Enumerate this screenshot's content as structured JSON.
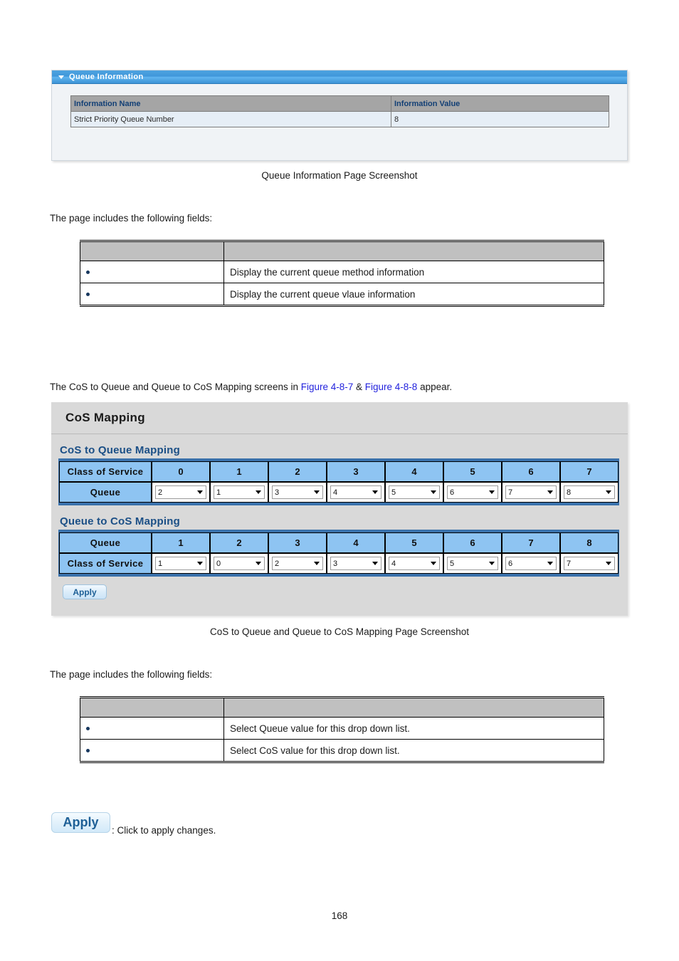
{
  "queue_information_panel": {
    "title": "Queue Information",
    "collapse_icon": "triangle-down-icon",
    "table": {
      "headers": [
        "Information Name",
        "Information Value"
      ],
      "rows": [
        {
          "name": "Strict Priority Queue Number",
          "value": "8"
        }
      ]
    }
  },
  "figure1_caption": "Queue Information Page Screenshot",
  "intro_text_1": "The page includes the following fields:",
  "field_table_1": {
    "headers": [
      "",
      ""
    ],
    "rows": [
      {
        "object": "",
        "description": "Display the current queue method information"
      },
      {
        "object": "",
        "description": "Display the current queue vlaue information"
      }
    ]
  },
  "body_text": {
    "prefix": "The CoS to Queue and Queue to CoS Mapping screens in ",
    "link1": "Figure 4-8-7",
    "middle": " & ",
    "link2": "Figure 4-8-8",
    "suffix": " appear.",
    "link_color": "#2222dd"
  },
  "cos_mapping_panel": {
    "title": "CoS Mapping",
    "cos_to_queue": {
      "section_label": "CoS to Queue Mapping",
      "row1_header": "Class of Service",
      "row1_values": [
        "0",
        "1",
        "2",
        "3",
        "4",
        "5",
        "6",
        "7"
      ],
      "row2_header": "Queue",
      "row2_selected": [
        "2",
        "1",
        "3",
        "4",
        "5",
        "6",
        "7",
        "8"
      ]
    },
    "queue_to_cos": {
      "section_label": "Queue to CoS Mapping",
      "row1_header": "Queue",
      "row1_values": [
        "1",
        "2",
        "3",
        "4",
        "5",
        "6",
        "7",
        "8"
      ],
      "row2_header": "Class of Service",
      "row2_selected": [
        "1",
        "0",
        "2",
        "3",
        "4",
        "5",
        "6",
        "7"
      ]
    },
    "apply_label": "Apply"
  },
  "figure2_caption": "CoS to Queue and Queue to CoS Mapping Page Screenshot",
  "intro_text_2": "The page includes the following fields:",
  "field_table_2": {
    "headers": [
      "",
      ""
    ],
    "rows": [
      {
        "object": "",
        "description": "Select Queue value for this drop down list."
      },
      {
        "object": "",
        "description": "Select CoS value for this drop down list."
      }
    ]
  },
  "apply_legend": {
    "button_label": "Apply",
    "description": ": Click to apply changes."
  },
  "page_number": "168",
  "colors": {
    "panel_title_blue": "#3f97da",
    "table_header_gray": "#a5a5a5",
    "table_row_lightblue": "#e6eef6",
    "map_header_blue": "#8ec4f2",
    "map_border_blue": "#3a72ac",
    "section_label_blue": "#1b4f86",
    "button_text_blue": "#1d5f96",
    "bullet_navy": "#17375e"
  }
}
